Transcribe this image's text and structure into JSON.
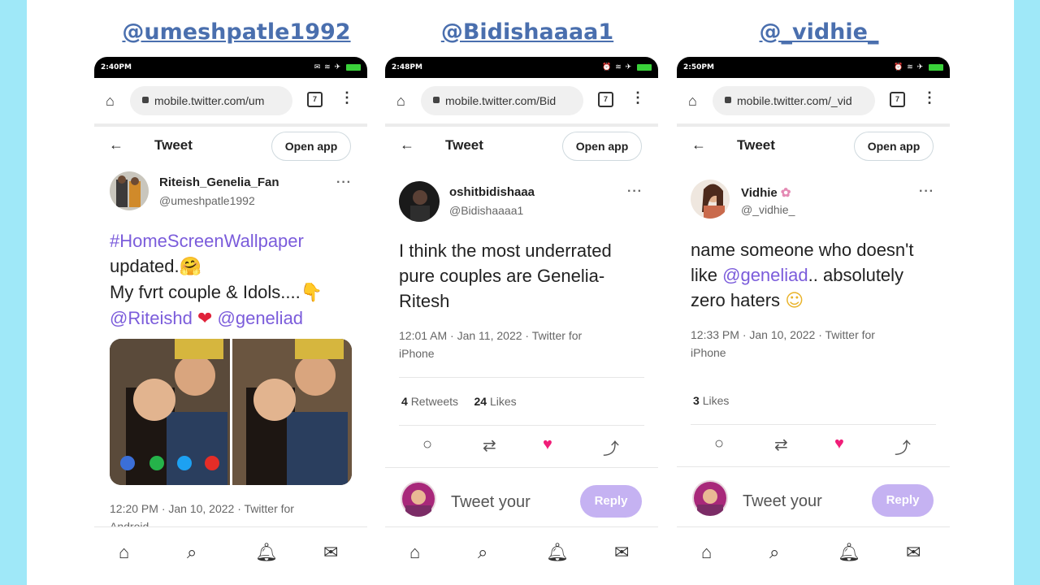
{
  "handles": [
    "@umeshpatle1992",
    "@Bidishaaaa1",
    "@_vidhie_"
  ],
  "common": {
    "url_prefix": "mobile.twitter.com/",
    "tab_count": "7",
    "header_title": "Tweet",
    "open_app_label": "Open app",
    "reply_placeholder": "Tweet your",
    "reply_label": "Reply"
  },
  "phones": [
    {
      "status_time": "2:40PM",
      "url": "mobile.twitter.com/um",
      "user_name": "Riteish_Genelia_Fan",
      "user_handle": "@umeshpatle1992",
      "tweet_line1_hashtag": "#HomeScreenWallpaper",
      "tweet_line2": "updated.",
      "tweet_line3": "My fvrt couple & Idols....",
      "tweet_mention1": "@Riteishd",
      "tweet_mention2": "@geneliad",
      "meta_line1": "12:20 PM · Jan 10, 2022 · Twitter for",
      "meta_line2": "Android"
    },
    {
      "status_time": "2:48PM",
      "url": "mobile.twitter.com/Bid",
      "user_name": "oshitbidishaaa",
      "user_handle": "@Bidishaaaa1",
      "tweet_text_line1": "I think the most underrated",
      "tweet_text_line2": "pure couples are Genelia-",
      "tweet_text_line3": "Ritesh",
      "meta_line1": "12:01 AM · Jan 11, 2022 · Twitter for",
      "meta_line2": "iPhone",
      "retweets_count": "4",
      "retweets_label": "Retweets",
      "likes_count": "24",
      "likes_label": "Likes"
    },
    {
      "status_time": "2:50PM",
      "url": "mobile.twitter.com/_vid",
      "user_name": "Vidhie",
      "user_handle": "@_vidhie_",
      "tweet_line1": "name someone who doesn't",
      "tweet_line2_pre": "like ",
      "tweet_mention": "@geneliad",
      "tweet_line2_post": ".. absolutely",
      "tweet_line3": "zero haters",
      "meta_line1": "12:33 PM · Jan 10, 2022 · Twitter for",
      "meta_line2": "iPhone",
      "likes_count": "3",
      "likes_label": "Likes"
    }
  ],
  "icons": [
    "home-icon",
    "lock-icon",
    "tabs-icon",
    "menu-icon",
    "back-icon",
    "more-icon",
    "reply-icon",
    "retweet-icon",
    "like-icon",
    "share-icon",
    "explore-icon",
    "search-icon",
    "notifications-icon",
    "messages-icon"
  ],
  "colors": {
    "background": "#9fe8f8",
    "handle_link": "#4a6fae",
    "mention": "#7b5cdb",
    "like": "#f01d78",
    "reply_button": "#c5b2f2"
  }
}
